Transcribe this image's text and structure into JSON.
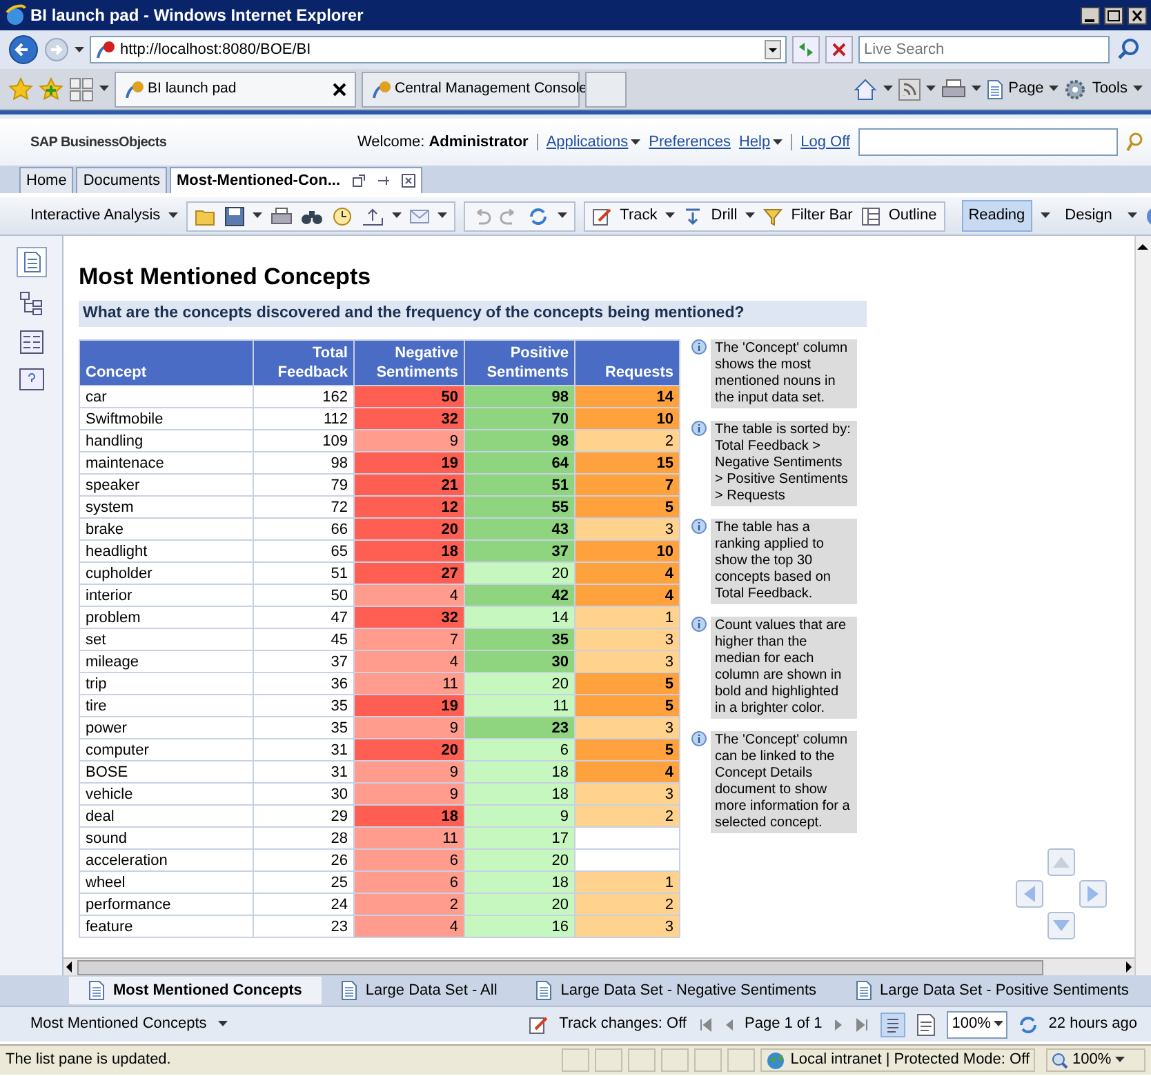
{
  "browser": {
    "title": "BI launch pad - Windows Internet Explorer",
    "address": "http://localhost:8080/BOE/BI",
    "search_placeholder": "Live Search",
    "tabs": [
      {
        "label": "BI launch pad",
        "selected": true
      },
      {
        "label": "Central Management Console",
        "selected": false
      }
    ],
    "commands": [
      "Page",
      "Tools"
    ]
  },
  "header": {
    "logo": "SAP Business**Objects**",
    "welcome": "Welcome: **Administrator**",
    "links": [
      {
        "label": "Applications",
        "menu": true
      },
      {
        "label": "Preferences",
        "menu": false
      },
      {
        "label": "Help",
        "menu": true
      },
      {
        "label": "Log Off",
        "menu": false
      }
    ]
  },
  "doc_tabs": [
    {
      "label": "Home",
      "selected": false
    },
    {
      "label": "Documents",
      "selected": false
    },
    {
      "label": "Most-Mentioned-Con...",
      "selected": true
    }
  ],
  "toolbar": {
    "app_menu": "Interactive Analysis",
    "tools": [
      "Track",
      "Drill",
      "Filter Bar",
      "Outline"
    ],
    "modes": [
      {
        "label": "Reading",
        "selected": true
      },
      {
        "label": "Design",
        "selected": false
      }
    ]
  },
  "report": {
    "title": "Most Mentioned Concepts",
    "subtitle": "What are the concepts discovered and the frequency of the concepts being mentioned?",
    "table": {
      "columns": [
        "Concept",
        "Total Feedback",
        "Negative Sentiments",
        "Positive Sentiments",
        "Requests"
      ],
      "rows": [
        {
          "concept": "car",
          "total": "162",
          "negative": {
            "value": "50",
            "high": true
          },
          "positive": {
            "value": "98",
            "high": true
          },
          "requests": {
            "value": "14",
            "high": true
          }
        },
        {
          "concept": "Swiftmobile",
          "total": "112",
          "negative": {
            "value": "32",
            "high": true
          },
          "positive": {
            "value": "70",
            "high": true
          },
          "requests": {
            "value": "10",
            "high": true
          }
        },
        {
          "concept": "handling",
          "total": "109",
          "negative": {
            "value": "9",
            "high": false
          },
          "positive": {
            "value": "98",
            "high": true
          },
          "requests": {
            "value": "2",
            "high": false
          }
        },
        {
          "concept": "maintenace",
          "total": "98",
          "negative": {
            "value": "19",
            "high": true
          },
          "positive": {
            "value": "64",
            "high": true
          },
          "requests": {
            "value": "15",
            "high": true
          }
        },
        {
          "concept": "speaker",
          "total": "79",
          "negative": {
            "value": "21",
            "high": true
          },
          "positive": {
            "value": "51",
            "high": true
          },
          "requests": {
            "value": "7",
            "high": true
          }
        },
        {
          "concept": "system",
          "total": "72",
          "negative": {
            "value": "12",
            "high": true
          },
          "positive": {
            "value": "55",
            "high": true
          },
          "requests": {
            "value": "5",
            "high": true
          }
        },
        {
          "concept": "brake",
          "total": "66",
          "negative": {
            "value": "20",
            "high": true
          },
          "positive": {
            "value": "43",
            "high": true
          },
          "requests": {
            "value": "3",
            "high": false
          }
        },
        {
          "concept": "headlight",
          "total": "65",
          "negative": {
            "value": "18",
            "high": true
          },
          "positive": {
            "value": "37",
            "high": true
          },
          "requests": {
            "value": "10",
            "high": true
          }
        },
        {
          "concept": "cupholder",
          "total": "51",
          "negative": {
            "value": "27",
            "high": true
          },
          "positive": {
            "value": "20",
            "high": false
          },
          "requests": {
            "value": "4",
            "high": true
          }
        },
        {
          "concept": "interior",
          "total": "50",
          "negative": {
            "value": "4",
            "high": false
          },
          "positive": {
            "value": "42",
            "high": true
          },
          "requests": {
            "value": "4",
            "high": true
          }
        },
        {
          "concept": "problem",
          "total": "47",
          "negative": {
            "value": "32",
            "high": true
          },
          "positive": {
            "value": "14",
            "high": false
          },
          "requests": {
            "value": "1",
            "high": false
          }
        },
        {
          "concept": "set",
          "total": "45",
          "negative": {
            "value": "7",
            "high": false
          },
          "positive": {
            "value": "35",
            "high": true
          },
          "requests": {
            "value": "3",
            "high": false
          }
        },
        {
          "concept": "mileage",
          "total": "37",
          "negative": {
            "value": "4",
            "high": false
          },
          "positive": {
            "value": "30",
            "high": true
          },
          "requests": {
            "value": "3",
            "high": false
          }
        },
        {
          "concept": "trip",
          "total": "36",
          "negative": {
            "value": "11",
            "high": false
          },
          "positive": {
            "value": "20",
            "high": false
          },
          "requests": {
            "value": "5",
            "high": true
          }
        },
        {
          "concept": "tire",
          "total": "35",
          "negative": {
            "value": "19",
            "high": true
          },
          "positive": {
            "value": "11",
            "high": false
          },
          "requests": {
            "value": "5",
            "high": true
          }
        },
        {
          "concept": "power",
          "total": "35",
          "negative": {
            "value": "9",
            "high": false
          },
          "positive": {
            "value": "23",
            "high": true
          },
          "requests": {
            "value": "3",
            "high": false
          }
        },
        {
          "concept": "computer",
          "total": "31",
          "negative": {
            "value": "20",
            "high": true
          },
          "positive": {
            "value": "6",
            "high": false
          },
          "requests": {
            "value": "5",
            "high": true
          }
        },
        {
          "concept": "BOSE",
          "total": "31",
          "negative": {
            "value": "9",
            "high": false
          },
          "positive": {
            "value": "18",
            "high": false
          },
          "requests": {
            "value": "4",
            "high": true
          }
        },
        {
          "concept": "vehicle",
          "total": "30",
          "negative": {
            "value": "9",
            "high": false
          },
          "positive": {
            "value": "18",
            "high": false
          },
          "requests": {
            "value": "3",
            "high": false
          }
        },
        {
          "concept": "deal",
          "total": "29",
          "negative": {
            "value": "18",
            "high": true
          },
          "positive": {
            "value": "9",
            "high": false
          },
          "requests": {
            "value": "2",
            "high": false
          }
        },
        {
          "concept": "sound",
          "total": "28",
          "negative": {
            "value": "11",
            "high": false
          },
          "positive": {
            "value": "17",
            "high": false
          }
        },
        {
          "concept": "acceleration",
          "total": "26",
          "negative": {
            "value": "6",
            "high": false
          },
          "positive": {
            "value": "20",
            "high": false
          }
        },
        {
          "concept": "wheel",
          "total": "25",
          "negative": {
            "value": "6",
            "high": false
          },
          "positive": {
            "value": "18",
            "high": false
          },
          "requests": {
            "value": "1",
            "high": false
          }
        },
        {
          "concept": "performance",
          "total": "24",
          "negative": {
            "value": "2",
            "high": false
          },
          "positive": {
            "value": "20",
            "high": false
          },
          "requests": {
            "value": "2",
            "high": false
          }
        },
        {
          "concept": "feature",
          "total": "23",
          "negative": {
            "value": "4",
            "high": false
          },
          "positive": {
            "value": "16",
            "high": false
          },
          "requests": {
            "value": "3",
            "high": false
          }
        }
      ]
    },
    "notes": [
      "The 'Concept' column shows the most mentioned nouns in the input data set.",
      "The table is sorted by: Total Feedback > Negative Sentiments > Positive Sentiments > Requests",
      "The table has a ranking applied to show  the top 30 concepts based on Total Feedback.",
      "Count values that are higher than the median for each column are shown in bold and highlighted in a brighter color.",
      "The 'Concept' column can be linked to the Concept Details document to show more information for a selected concept."
    ]
  },
  "sheet_tabs": [
    {
      "label": "Most Mentioned Concepts",
      "selected": true
    },
    {
      "label": "Large Data Set - All",
      "selected": false
    },
    {
      "label": "Large Data Set - Negative Sentiments",
      "selected": false
    },
    {
      "label": "Large Data Set - Positive Sentiments",
      "selected": false
    }
  ],
  "status": {
    "report": "Most Mentioned Concepts",
    "track": "Track changes: Off",
    "page": "Page 1 of 1",
    "zoom": "100%",
    "refreshed": "22 hours ago"
  },
  "ie_status": {
    "message": "The list pane is updated.",
    "zone": "Local intranet | Protected Mode: Off",
    "zoom": "100%"
  }
}
